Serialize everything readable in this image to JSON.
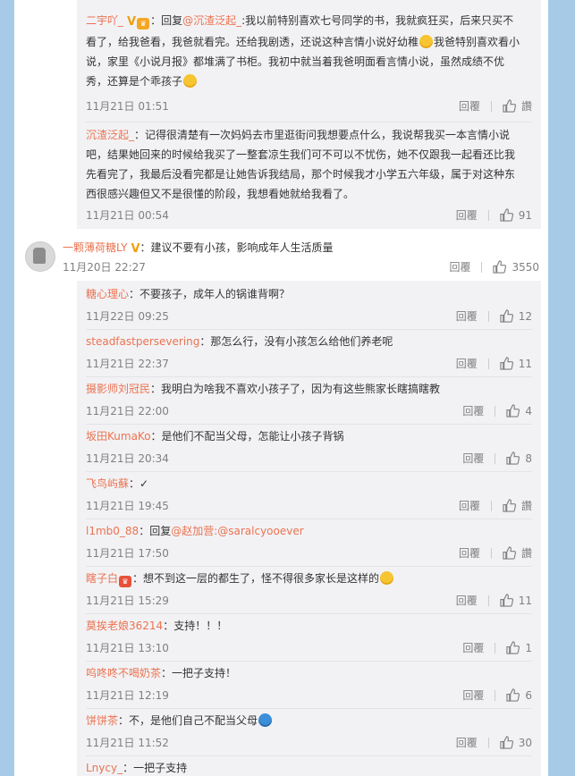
{
  "labels": {
    "reply": "回覆"
  },
  "top_thread": {
    "items": [
      {
        "name": "二宇吖_",
        "text_pre": "：回复",
        "mention": "@沉渣泛起_",
        "text": ":我以前特别喜欢七号同学的书，我就疯狂买，后来只买不看了，给我爸看，我爸就看完。还给我剧透，还说这种言情小说好幼稚",
        "text2": "我爸特别喜欢看小说，家里《小说月报》都堆满了书柜。我初中就当着我爸明面看言情小说，虽然成绩不优秀，还算是个乖孩子",
        "time": "11月21日 01:51",
        "like_label": "讚"
      },
      {
        "name": "沉渣泛起_",
        "text": "：记得很清楚有一次妈妈去市里逛街问我想要点什么，我说帮我买一本言情小说吧，结果她回来的时候给我买了一整套凉生我们可不可以不忧伤，她不仅跟我一起看还比我先看完了，我最后没看完都是让她告诉我结局，那个时候我才小学五六年级，属于对这种东西很感兴趣但又不是很懂的阶段，我想看她就给我看了。",
        "time": "11月21日 00:54",
        "like_label": "91"
      }
    ]
  },
  "main_comment": {
    "name": "一颗薄荷糖LY",
    "text": "：建议不要有小孩，影响成年人生活质量",
    "time": "11月20日 22:27",
    "like_label": "3550"
  },
  "replies": [
    {
      "name": "糖心理心",
      "text": "：不要孩子，成年人的锅谁背啊？",
      "time": "11月22日 09:25",
      "like_label": "12"
    },
    {
      "name": "steadfastpersevering",
      "text": "：那怎么行，没有小孩怎么给他们养老呢",
      "time": "11月21日 22:37",
      "like_label": "11"
    },
    {
      "name": "摄影师刘冠民",
      "text": "：我明白为啥我不喜欢小孩子了，因为有这些熊家长瞎搞瞎教",
      "time": "11月21日 22:00",
      "like_label": "4"
    },
    {
      "name": "坂田KumaKo",
      "text": "：是他们不配当父母，怎能让小孩子背锅",
      "time": "11月21日 20:34",
      "like_label": "8"
    },
    {
      "name": "飞鸟屿蘇",
      "text": "：✓",
      "time": "11月21日 19:45",
      "like_label": "讚"
    },
    {
      "name": "l1mb0_88",
      "text": "：回复",
      "mention": "@赵加营:@saralcyooever",
      "time": "11月21日 17:50",
      "like_label": "讚"
    },
    {
      "name": "瞎子白",
      "text": "：想不到这一层的都生了，怪不得很多家长是这样的",
      "time": "11月21日 15:29",
      "like_label": "11"
    },
    {
      "name": "莫挨老娘36214",
      "text": "：支持！！！",
      "time": "11月21日 13:10",
      "like_label": "1"
    },
    {
      "name": "呜咚咚不喝奶茶",
      "text": "：一把子支持！",
      "time": "11月21日 12:19",
      "like_label": "6"
    },
    {
      "name": "饼饼茶",
      "text": "：不，是他们自己不配当父母",
      "time": "11月21日 11:52",
      "like_label": "30"
    },
    {
      "name": "Lnycy_",
      "text": "：一把子支持"
    }
  ],
  "colors": {
    "name": "#eb7350",
    "background": "#a7cbe6",
    "reply_bg": "#f2f2f5"
  },
  "icons": {
    "like": "thumbs-up-icon",
    "verified": "v-badge-icon",
    "vip": "vip-badge-icon",
    "emoji": "grin-emoji-icon"
  }
}
